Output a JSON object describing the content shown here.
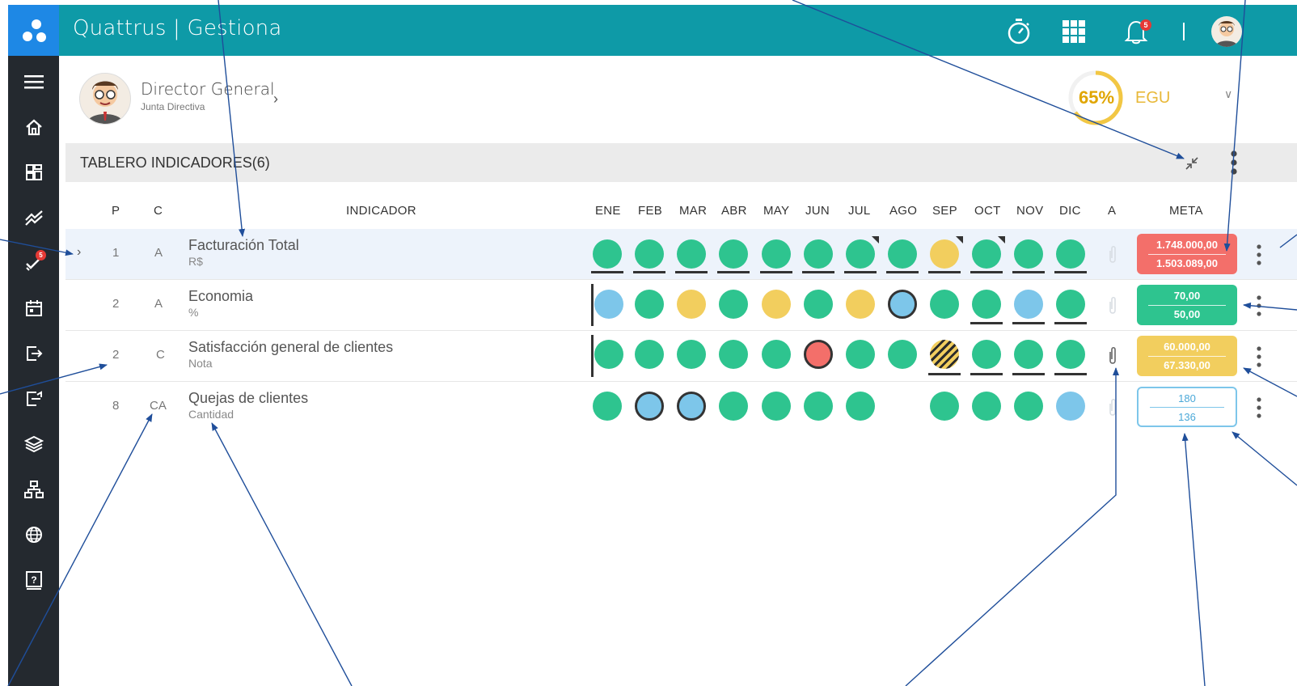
{
  "app": {
    "title": "Quattrus | Gestiona",
    "notifications": "5"
  },
  "sidebar": {
    "badge": "5"
  },
  "profile": {
    "name": "Director General",
    "department": "Junta Directiva"
  },
  "egu": {
    "percent": "65%",
    "label": "EGU",
    "value": 0.65
  },
  "board": {
    "title": "TABLERO INDICADORES(6)",
    "headers": {
      "p": "P",
      "c": "C",
      "indicator": "INDICADOR",
      "a": "A",
      "meta": "META",
      "months": [
        "ENE",
        "FEB",
        "MAR",
        "ABR",
        "MAY",
        "JUN",
        "JUL",
        "AGO",
        "SEP",
        "OCT",
        "NOV",
        "DIC"
      ]
    },
    "rows": [
      {
        "p": "1",
        "c": "A",
        "name": "Facturación Total",
        "unit": "R$",
        "meta_top": "1.748.000,00",
        "meta_bottom": "1.503.089,00",
        "meta_style": "red"
      },
      {
        "p": "2",
        "c": "A",
        "name": "Economia",
        "unit": "%",
        "meta_top": "70,00",
        "meta_bottom": "50,00",
        "meta_style": "green"
      },
      {
        "p": "2",
        "c": "C",
        "name": "Satisfacción general de clientes",
        "unit": "Nota",
        "meta_top": "60.000,00",
        "meta_bottom": "67.330,00",
        "meta_style": "yellow"
      },
      {
        "p": "8",
        "c": "CA",
        "name": "Quejas de clientes",
        "unit": "Cantidad",
        "meta_top": "180",
        "meta_bottom": "136",
        "meta_style": "outline"
      }
    ]
  },
  "colors": {
    "green": "#2ec48f",
    "yellow": "#f2ce5e",
    "blue": "#7dc6ea",
    "red": "#f36f6a",
    "teal": "#0e9aa7",
    "sidebar": "#24292f"
  }
}
